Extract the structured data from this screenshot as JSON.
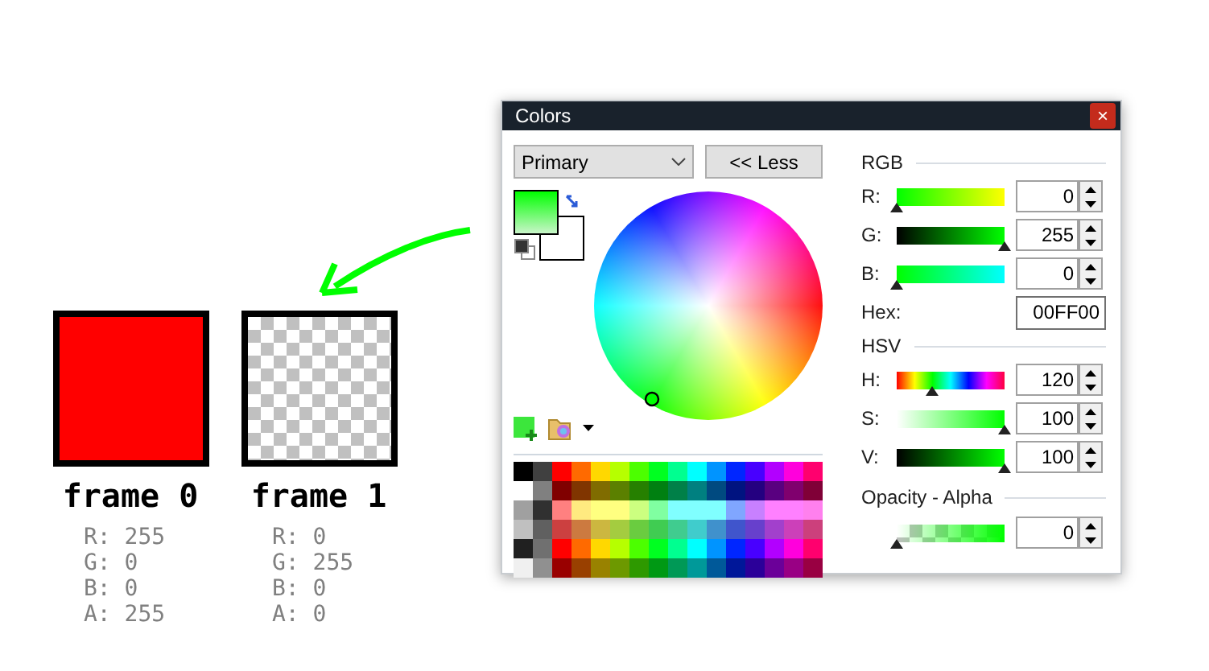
{
  "frames": [
    {
      "label": "frame 0",
      "kind": "solid",
      "color": "#ff0000",
      "values": [
        "R: 255",
        "G: 0",
        "B: 0",
        "A: 255"
      ]
    },
    {
      "label": "frame 1",
      "kind": "transparent",
      "values": [
        "R: 0",
        "G: 255",
        "B: 0",
        "A: 0"
      ]
    }
  ],
  "window": {
    "title": "Colors",
    "close": "×"
  },
  "mode_select": {
    "value": "Primary"
  },
  "less_button": "<< Less",
  "rgb": {
    "title": "RGB",
    "channels": [
      {
        "label": "R:",
        "level": 0,
        "value": "0"
      },
      {
        "label": "G:",
        "level": 1,
        "value": "255"
      },
      {
        "label": "B:",
        "level": 0,
        "value": "0"
      }
    ],
    "hex_label": "Hex:",
    "hex_value": "00FF00"
  },
  "hsv": {
    "title": "HSV",
    "channels": [
      {
        "label": "H:",
        "level": 0.333,
        "value": "120"
      },
      {
        "label": "S:",
        "level": 1,
        "value": "100"
      },
      {
        "label": "V:",
        "level": 1,
        "value": "100"
      }
    ]
  },
  "opacity": {
    "title": "Opacity - Alpha",
    "level": 0,
    "value": "0"
  }
}
